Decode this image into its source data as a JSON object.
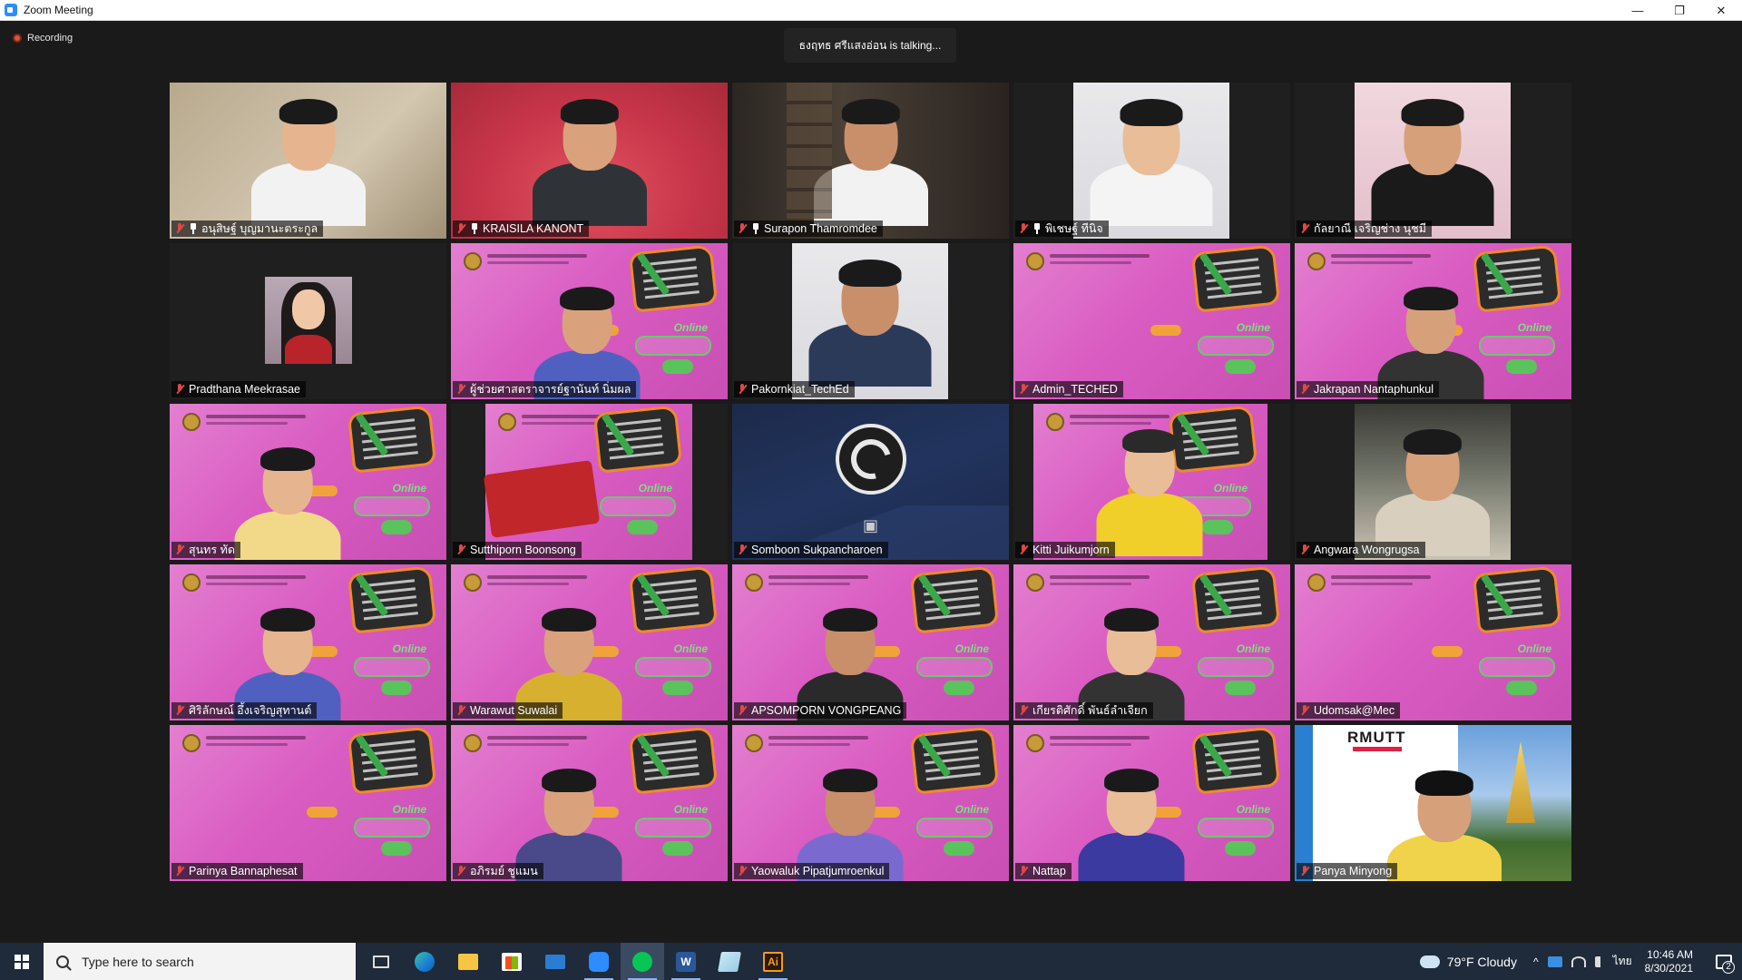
{
  "window": {
    "title": "Zoom Meeting",
    "minimize": "—",
    "restore": "❐",
    "close": "✕"
  },
  "meeting": {
    "recording_label": "Recording",
    "talking_banner": "ธงฤทธ ศรีแสงอ่อน is talking...",
    "participants": [
      {
        "name": "อนุสิษฐ์ บุญมานะตระกูล",
        "pinned": true,
        "muted": true,
        "bg": "beige"
      },
      {
        "name": "KRAISILA KANONT",
        "pinned": true,
        "muted": true,
        "bg": "red"
      },
      {
        "name": "Surapon Thamromdee",
        "pinned": true,
        "muted": true,
        "bg": "room"
      },
      {
        "name": "พิเชษฐ์ ทีนิจ",
        "pinned": true,
        "muted": true,
        "bg": "portrait-light"
      },
      {
        "name": "กัลยาณี เจริญช่าง นุชมี",
        "pinned": false,
        "muted": true,
        "bg": "portrait-pink"
      },
      {
        "name": "Pradthana Meekrasae",
        "pinned": false,
        "muted": true,
        "bg": "small-photo"
      },
      {
        "name": "ผู้ช่วยศาสตราจารย์ฐานันท์ นิ่มผล",
        "pinned": false,
        "muted": true,
        "bg": "pink"
      },
      {
        "name": "Pakornkiat_TechEd",
        "pinned": false,
        "muted": true,
        "bg": "portrait-light"
      },
      {
        "name": "Admin_TECHED",
        "pinned": false,
        "muted": true,
        "bg": "pink"
      },
      {
        "name": "Jakrapan Nantaphunkul",
        "pinned": false,
        "muted": true,
        "bg": "pink"
      },
      {
        "name": "สุนทร ทัด",
        "pinned": false,
        "muted": true,
        "bg": "pink"
      },
      {
        "name": "Sutthiporn Boonsong",
        "pinned": false,
        "muted": true,
        "bg": "pink-narrow"
      },
      {
        "name": "Somboon Sukpancharoen",
        "pinned": false,
        "muted": true,
        "bg": "obs"
      },
      {
        "name": "Kitti Juikumjorn",
        "pinned": false,
        "muted": true,
        "bg": "pink-narrow"
      },
      {
        "name": "Angwara Wongrugsa",
        "pinned": false,
        "muted": true,
        "bg": "portrait-window"
      },
      {
        "name": "ศิริลักษณ์ อึ้งเจริญสุทานต์",
        "pinned": false,
        "muted": true,
        "bg": "pink",
        "active": true
      },
      {
        "name": "Warawut Suwalai",
        "pinned": false,
        "muted": true,
        "bg": "pink"
      },
      {
        "name": "APSOMPORN VONGPEANG",
        "pinned": false,
        "muted": true,
        "bg": "pink"
      },
      {
        "name": "เกียรติศักดิ์ พันธ์ลำเจียก",
        "pinned": false,
        "muted": true,
        "bg": "pink"
      },
      {
        "name": "Udomsak@Mec",
        "pinned": false,
        "muted": true,
        "bg": "pink"
      },
      {
        "name": "Parinya Bannaphesat",
        "pinned": false,
        "muted": true,
        "bg": "pink"
      },
      {
        "name": "อภิรมย์ ชูแมน",
        "pinned": false,
        "muted": true,
        "bg": "pink"
      },
      {
        "name": "Yaowaluk Pipatjumroenkul",
        "pinned": false,
        "muted": true,
        "bg": "pink"
      },
      {
        "name": "Nattap",
        "pinned": false,
        "muted": true,
        "bg": "pink"
      },
      {
        "name": "Panya Minyong",
        "pinned": false,
        "muted": true,
        "bg": "rmutt"
      }
    ],
    "poster_online_text": "Online",
    "rmutt_logo_text": "RMUTT"
  },
  "taskbar": {
    "search_placeholder": "Type here to search",
    "apps": [
      "task-view",
      "edge",
      "file-explorer",
      "store",
      "mail",
      "zoom",
      "line",
      "word",
      "notes",
      "illustrator"
    ],
    "word_glyph": "W",
    "ai_glyph": "Ai",
    "weather": "79°F  Cloudy",
    "chevron": "^",
    "language": "ไทย",
    "time": "10:46 AM",
    "date": "8/30/2021",
    "notification_count": "2"
  }
}
